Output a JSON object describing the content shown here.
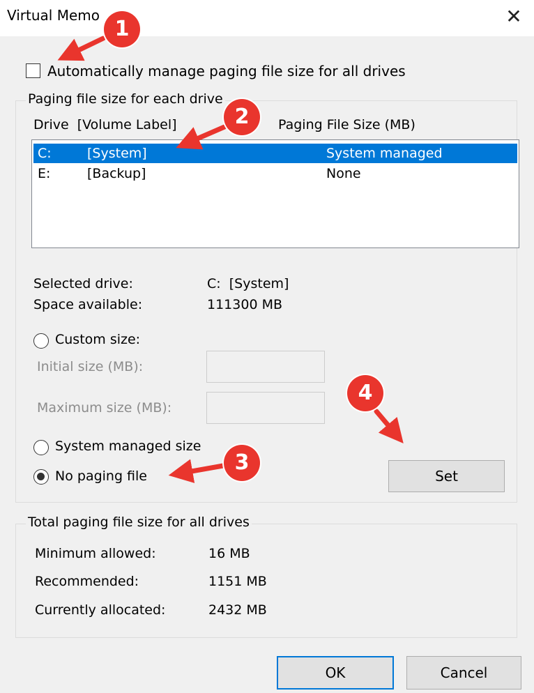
{
  "window": {
    "title": "Virtual Memo"
  },
  "auto_manage": {
    "label": "Automatically manage paging file size for all drives",
    "checked": false
  },
  "per_drive": {
    "legend": "Paging file size for each drive",
    "header_drive": "Drive  [Volume Label]",
    "header_size": "Paging File Size (MB)",
    "drives": [
      {
        "letter": "C:",
        "label": "[System]",
        "size": "System managed",
        "selected": true
      },
      {
        "letter": "E:",
        "label": "[Backup]",
        "size": "None",
        "selected": false
      }
    ],
    "selected_drive_label": "Selected drive:",
    "selected_drive_value": "C:  [System]",
    "space_label": "Space available:",
    "space_value": "111300 MB",
    "custom_size_label": "Custom size:",
    "initial_label": "Initial size (MB):",
    "max_label": "Maximum size (MB):",
    "system_managed_label": "System managed size",
    "no_paging_label": "No paging file",
    "selected_option": "no_paging",
    "set_label": "Set"
  },
  "totals": {
    "legend": "Total paging file size for all drives",
    "min_label": "Minimum allowed:",
    "min_value": "16 MB",
    "rec_label": "Recommended:",
    "rec_value": "1151 MB",
    "cur_label": "Currently allocated:",
    "cur_value": "2432 MB"
  },
  "buttons": {
    "ok": "OK",
    "cancel": "Cancel"
  },
  "annotations": {
    "b1": "1",
    "b2": "2",
    "b3": "3",
    "b4": "4",
    "color": "#e9352d"
  }
}
